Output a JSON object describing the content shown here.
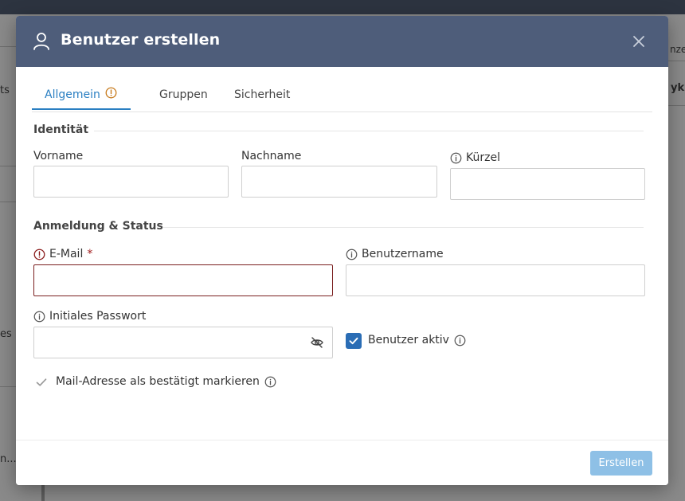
{
  "background": {
    "left_text_1": "ts",
    "left_text_2": "es",
    "left_text_3": "n...",
    "right_text_1": "nzei",
    "right_text_2": "ykl."
  },
  "modal": {
    "title": "Benutzer erstellen",
    "tabs": [
      {
        "label": "Allgemein",
        "active": true,
        "warning": true
      },
      {
        "label": "Gruppen",
        "active": false
      },
      {
        "label": "Sicherheit",
        "active": false
      }
    ],
    "sections": {
      "identity": {
        "title": "Identität",
        "first_name": {
          "label": "Vorname",
          "value": ""
        },
        "last_name": {
          "label": "Nachname",
          "value": ""
        },
        "short": {
          "label": "Kürzel",
          "value": ""
        }
      },
      "login": {
        "title": "Anmeldung & Status",
        "email": {
          "label": "E-Mail",
          "required_mark": "*",
          "value": ""
        },
        "username": {
          "label": "Benutzername",
          "value": ""
        },
        "password": {
          "label": "Initiales Passwort",
          "value": ""
        },
        "user_active": {
          "label": "Benutzer aktiv",
          "checked": true
        },
        "mail_confirmed": {
          "label": "Mail-Adresse als bestätigt markieren",
          "checked": false
        }
      }
    },
    "footer": {
      "create_label": "Erstellen"
    }
  },
  "colors": {
    "header_bg": "#4e5d7a",
    "accent": "#2a7fc2",
    "error": "#7a1f1f",
    "button_disabled": "#8ec0e6"
  }
}
